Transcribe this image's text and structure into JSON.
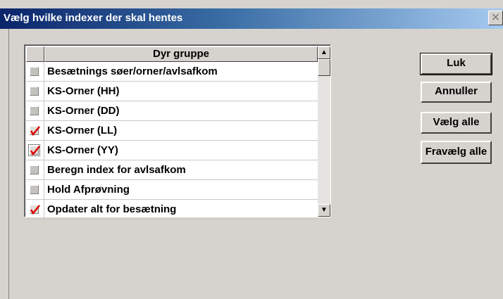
{
  "window": {
    "title": "Vælg hvilke indexer der skal hentes",
    "close_label": "✕"
  },
  "list": {
    "header": "Dyr gruppe",
    "rows": [
      {
        "label": "Besætnings søer/orner/avlsafkom",
        "checked": false
      },
      {
        "label": "KS-Orner (HH)",
        "checked": false
      },
      {
        "label": "KS-Orner (DD)",
        "checked": false
      },
      {
        "label": "KS-Orner (LL)",
        "checked": true
      },
      {
        "label": "KS-Orner (YY)",
        "checked": true,
        "focused": true
      },
      {
        "label": "Beregn index for avlsafkom",
        "checked": false
      },
      {
        "label": "Hold Afprøvning",
        "checked": false
      },
      {
        "label": "Opdater alt for besætning",
        "checked": true
      }
    ],
    "scroll_up": "▲",
    "scroll_down": "▼"
  },
  "buttons": {
    "close": "Luk",
    "cancel": "Annuller",
    "select_all": "Vælg alle",
    "deselect_all": "Fravælg alle"
  },
  "colors": {
    "check_mark": "#e00000",
    "title_gradient_start": "#0a246a",
    "title_gradient_end": "#a6caf0"
  }
}
